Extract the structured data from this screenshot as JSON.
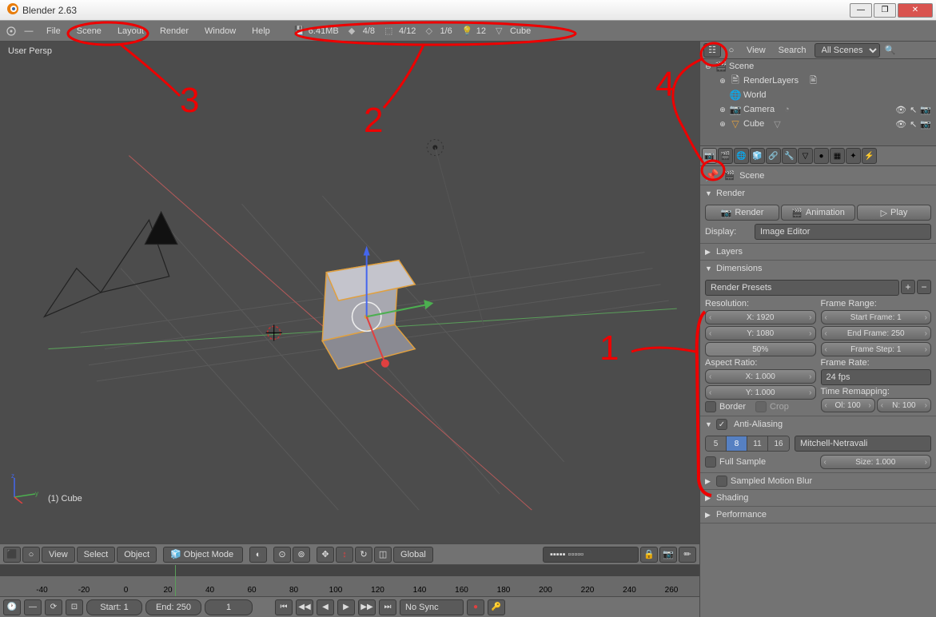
{
  "window": {
    "title": "Blender 2.63",
    "controls": {
      "minimize": "—",
      "maximize": "❐",
      "close": "✕"
    }
  },
  "top_menu": {
    "items": [
      "File",
      "Scene",
      "Layout",
      "Render",
      "Window",
      "Help"
    ],
    "stats": [
      {
        "icon": "mem-icon",
        "value": "6.41MB"
      },
      {
        "icon": "verts-icon",
        "value": "4/8"
      },
      {
        "icon": "edges-icon",
        "value": "4/12"
      },
      {
        "icon": "faces-icon",
        "value": "1/6"
      },
      {
        "icon": "lamps-icon",
        "value": "12"
      },
      {
        "icon": "object-icon",
        "value": "Cube"
      }
    ]
  },
  "viewport": {
    "perspective_label": "User Persp",
    "active_object": "(1) Cube",
    "header": {
      "view": "View",
      "select": "Select",
      "object": "Object",
      "mode": "Object Mode",
      "orientation": "Global"
    },
    "timeline_ticks": [
      -40,
      -20,
      0,
      20,
      40,
      60,
      80,
      100,
      120,
      140,
      160,
      180,
      200,
      220,
      240,
      260
    ],
    "timeline": {
      "start": "Start: 1",
      "end": "End: 250",
      "current": "1",
      "sync": "No Sync"
    }
  },
  "outliner": {
    "header": {
      "view": "View",
      "search": "Search",
      "filter": "All Scenes"
    },
    "scene": "Scene",
    "items": [
      {
        "indent": 1,
        "icon": "🖹",
        "label": "RenderLayers",
        "trail_icon": "🖹",
        "eye": false
      },
      {
        "indent": 1,
        "icon": "◉",
        "label": "World",
        "eye": false
      },
      {
        "indent": 1,
        "icon": "📷",
        "label": "Camera",
        "trail_icon": "◔",
        "eye": true
      },
      {
        "indent": 1,
        "icon": "▽",
        "label": "Cube",
        "trail_icon": "▽",
        "eye": true
      }
    ]
  },
  "props": {
    "context_scene": "Scene",
    "render": {
      "title": "Render",
      "render_btn": "Render",
      "anim_btn": "Animation",
      "play_btn": "Play",
      "display_label": "Display:",
      "display_value": "Image Editor"
    },
    "layers": {
      "title": "Layers"
    },
    "dimensions": {
      "title": "Dimensions",
      "presets": "Render Presets",
      "resolution_label": "Resolution:",
      "res_x": "X: 1920",
      "res_y": "Y: 1080",
      "res_pct": "50%",
      "aspect_label": "Aspect Ratio:",
      "asp_x": "X: 1.000",
      "asp_y": "Y: 1.000",
      "border": "Border",
      "crop": "Crop",
      "frame_range_label": "Frame Range:",
      "start_frame": "Start Frame: 1",
      "end_frame": "End Frame: 250",
      "frame_step": "Frame Step: 1",
      "frame_rate_label": "Frame Rate:",
      "fps": "24 fps",
      "time_remap_label": "Time Remapping:",
      "old": "Ol: 100",
      "new": "N: 100"
    },
    "antialias": {
      "title": "Anti-Aliasing",
      "samples": [
        "5",
        "8",
        "11",
        "16"
      ],
      "active_sample": "8",
      "filter": "Mitchell-Netravali",
      "full_sample": "Full Sample",
      "size": "Size: 1.000"
    },
    "motion_blur": {
      "title": "Sampled Motion Blur"
    },
    "shading": {
      "title": "Shading"
    },
    "performance": {
      "title": "Performance"
    }
  },
  "annotations": {
    "n1": "1",
    "n2": "2",
    "n3": "3",
    "n4": "4"
  }
}
